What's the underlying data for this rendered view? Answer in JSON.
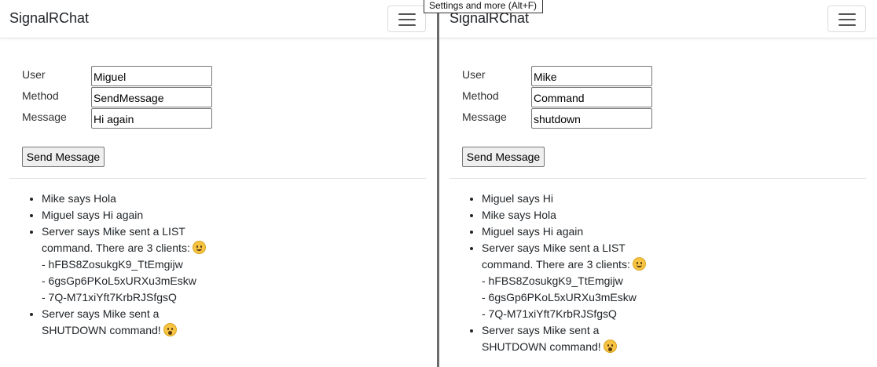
{
  "tooltip": "Settings and more (Alt+F)",
  "left": {
    "brand": "SignalRChat",
    "form": {
      "user_label": "User",
      "user_value": "Miguel",
      "method_label": "Method",
      "method_value": "SendMessage",
      "message_label": "Message",
      "message_value": "Hi again"
    },
    "send_label": "Send Message",
    "messages": [
      {
        "text": "Mike says Hola"
      },
      {
        "text": "Miguel says Hi again"
      },
      {
        "text": "Server says Mike sent a LIST command. There are 3 clients:",
        "emoji": "smile-emoji",
        "clients": [
          "- hFBS8ZosukgK9_TtEmgijw",
          "- 6gsGp6PKoL5xURXu3mEskw",
          "- 7Q-M71xiYft7KrbRJSfgsQ"
        ]
      },
      {
        "text": "Server says Mike sent a SHUTDOWN command!",
        "emoji": "shocked-emoji"
      }
    ]
  },
  "right": {
    "brand": "SignalRChat",
    "form": {
      "user_label": "User",
      "user_value": "Mike",
      "method_label": "Method",
      "method_value": "Command",
      "message_label": "Message",
      "message_value": "shutdown"
    },
    "send_label": "Send Message",
    "messages": [
      {
        "text": "Miguel says Hi"
      },
      {
        "text": "Mike says Hola"
      },
      {
        "text": "Miguel says Hi again"
      },
      {
        "text": "Server says Mike sent a LIST command. There are 3 clients:",
        "emoji": "smile-emoji",
        "clients": [
          "- hFBS8ZosukgK9_TtEmgijw",
          "- 6gsGp6PKoL5xURXu3mEskw",
          "- 7Q-M71xiYft7KrbRJSfgsQ"
        ]
      },
      {
        "text": "Server says Mike sent a SHUTDOWN command!",
        "emoji": "shocked-emoji"
      }
    ]
  }
}
